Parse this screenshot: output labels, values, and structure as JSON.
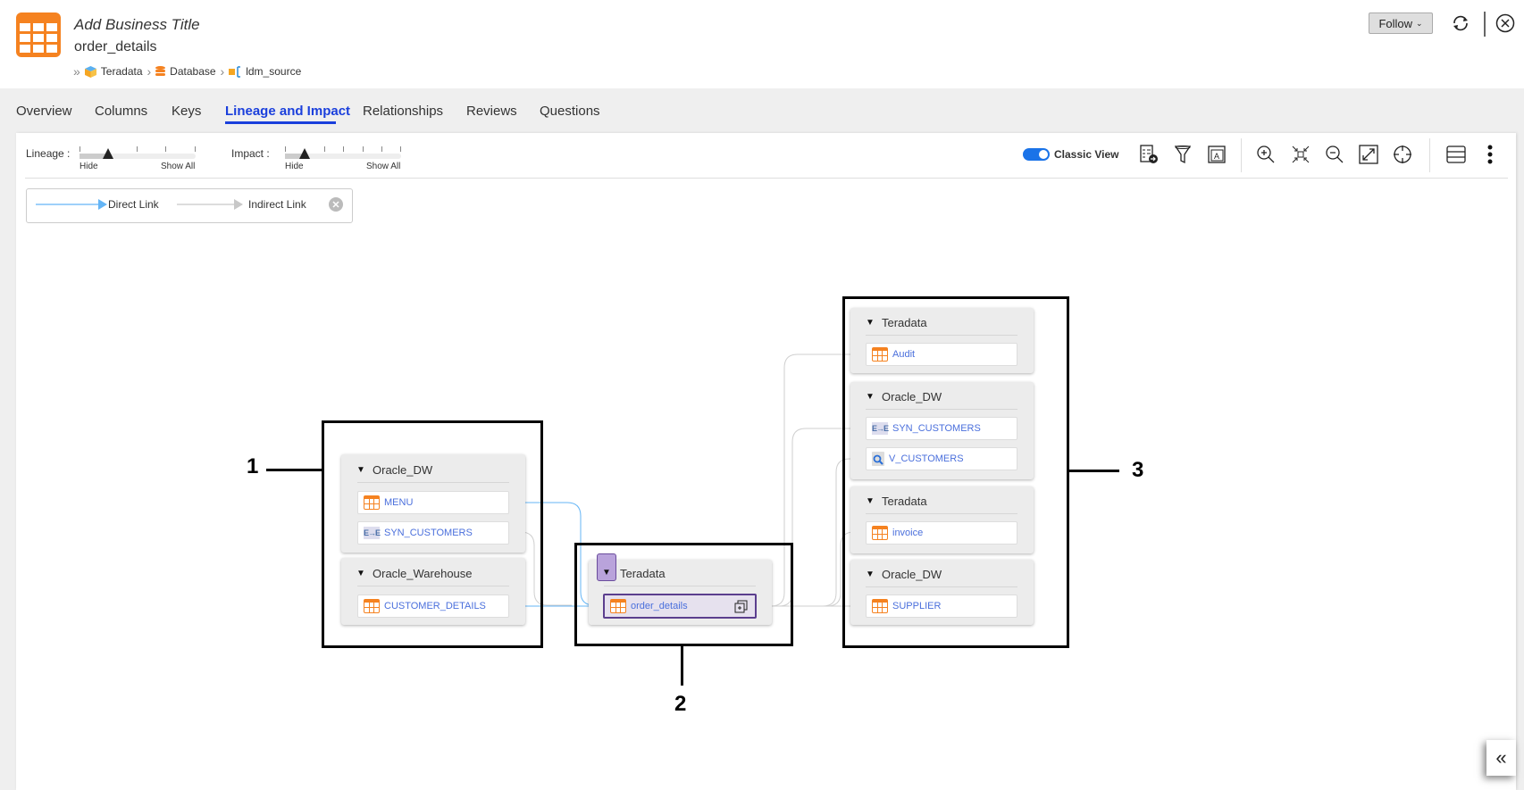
{
  "header": {
    "business_title": "Add Business Title",
    "object_name": "order_details",
    "breadcrumb": [
      {
        "label": "Teradata",
        "icon": "cube-icon"
      },
      {
        "label": "Database",
        "icon": "database-icon"
      },
      {
        "label": "ldm_source",
        "icon": "schema-icon"
      }
    ],
    "follow_label": "Follow",
    "colors": {
      "brand": "#f58220",
      "active_tab": "#1a3fdc"
    }
  },
  "tabs": [
    {
      "label": "Overview"
    },
    {
      "label": "Columns"
    },
    {
      "label": "Keys"
    },
    {
      "label": "Lineage and Impact",
      "active": true
    },
    {
      "label": "Relationships"
    },
    {
      "label": "Reviews"
    },
    {
      "label": "Questions"
    }
  ],
  "toolbar": {
    "lineage_label": "Lineage :",
    "impact_label": "Impact :",
    "slider_min_label": "Hide",
    "slider_max_label": "Show All",
    "lineage_level": 1,
    "impact_level": 1,
    "classic_view_label": "Classic View",
    "classic_view_on": true
  },
  "legend": {
    "direct_label": "Direct Link",
    "indirect_label": "Indirect Link",
    "direct_color": "#64b5f6",
    "indirect_color": "#c8c8c8"
  },
  "diagram": {
    "groups": [
      {
        "annotation": "1",
        "cards": [
          {
            "title": "Oracle_DW",
            "items": [
              {
                "label": "MENU",
                "type": "table"
              },
              {
                "label": "SYN_CUSTOMERS",
                "type": "synonym"
              }
            ]
          },
          {
            "title": "Oracle_Warehouse",
            "items": [
              {
                "label": "CUSTOMER_DETAILS",
                "type": "table"
              }
            ]
          }
        ]
      },
      {
        "annotation": "2",
        "cards": [
          {
            "title": "Teradata",
            "items": [
              {
                "label": "order_details",
                "type": "table",
                "selected": true
              }
            ]
          }
        ]
      },
      {
        "annotation": "3",
        "cards": [
          {
            "title": "Teradata",
            "items": [
              {
                "label": "Audit",
                "type": "table"
              }
            ]
          },
          {
            "title": "Oracle_DW",
            "items": [
              {
                "label": "SYN_CUSTOMERS",
                "type": "synonym"
              },
              {
                "label": "V_CUSTOMERS",
                "type": "view"
              }
            ]
          },
          {
            "title": "Teradata",
            "items": [
              {
                "label": "invoice",
                "type": "table"
              }
            ]
          },
          {
            "title": "Oracle_DW",
            "items": [
              {
                "label": "SUPPLIER",
                "type": "table"
              }
            ]
          }
        ]
      }
    ]
  }
}
